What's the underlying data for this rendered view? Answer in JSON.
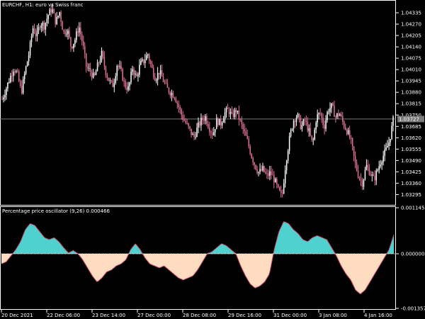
{
  "window": {
    "symbol_title": "EURCHF, H1:  euro vs Swiss franc",
    "indicator_title": "Percentage price oscillator (9,26) 0.000466"
  },
  "colors": {
    "background": "#000000",
    "frame": "#ffffff",
    "bull_candle": "#ffffff",
    "bear_candle": "#e0709a",
    "oscillator_positive": "#4fd1d0",
    "oscillator_negative": "#fddcc0",
    "oscillator_line": "#d05070",
    "current_price_line": "#7a7a7a"
  },
  "chart_data": [
    {
      "type": "candlestick",
      "title": "EURCHF, H1:  euro vs Swiss franc",
      "ylim": [
        1.0324,
        1.044
      ],
      "y_ticks": [
        "1.04335",
        "1.04270",
        "1.04205",
        "1.04140",
        "1.04075",
        "1.04010",
        "1.03945",
        "1.03880",
        "1.03815",
        "1.03750",
        "1.03685",
        "1.03620",
        "1.03555",
        "1.03490",
        "1.03425",
        "1.03360",
        "1.03295"
      ],
      "current_price": 1.03727,
      "current_price_label": "1.03727",
      "x_ticks": [
        "20 Dec 2021",
        "22 Dec 06:00",
        "23 Dec 14:00",
        "27 Dec 00:00",
        "28 Dec 08:00",
        "29 Dec 16:00",
        "31 Dec 00:00",
        "3 Jan 08:00",
        "4 Jan 16:00"
      ],
      "close_path": [
        1.0384,
        1.039,
        1.0396,
        1.0402,
        1.0398,
        1.0388,
        1.04,
        1.041,
        1.0425,
        1.042,
        1.0428,
        1.0426,
        1.0432,
        1.0436,
        1.0428,
        1.0434,
        1.0422,
        1.0424,
        1.0414,
        1.0418,
        1.0426,
        1.0416,
        1.0402,
        1.04,
        1.0396,
        1.0404,
        1.041,
        1.04,
        1.0394,
        1.0392,
        1.0404,
        1.04,
        1.0392,
        1.039,
        1.0402,
        1.0396,
        1.0404,
        1.0406,
        1.041,
        1.0402,
        1.0396,
        1.04,
        1.0395,
        1.039,
        1.0388,
        1.0386,
        1.038,
        1.0374,
        1.037,
        1.0366,
        1.0362,
        1.0368,
        1.0372,
        1.0374,
        1.0368,
        1.0364,
        1.0372,
        1.037,
        1.0376,
        1.0378,
        1.0374,
        1.0378,
        1.0372,
        1.0366,
        1.036,
        1.0352,
        1.0346,
        1.0342,
        1.0344,
        1.034,
        1.0342,
        1.0338,
        1.0332,
        1.0328,
        1.0348,
        1.0362,
        1.0372,
        1.0375,
        1.0368,
        1.0372,
        1.0366,
        1.0358,
        1.0374,
        1.0376,
        1.0368,
        1.0378,
        1.038,
        1.0374,
        1.0376,
        1.037,
        1.0366,
        1.036,
        1.0348,
        1.034,
        1.0336,
        1.0346,
        1.0342,
        1.0338,
        1.0344,
        1.035,
        1.0354,
        1.036,
        1.0372
      ]
    },
    {
      "type": "area",
      "title": "Percentage price oscillator (9,26) 0.000466",
      "ylim": [
        -0.001357,
        0.001145
      ],
      "y_ticks": [
        "0.001145",
        "0.000000",
        "-0.001357"
      ],
      "current_value": 0.000466,
      "values": [
        -0.00025,
        -0.0002,
        -5e-05,
        0.0001,
        0.0003,
        0.0006,
        0.00075,
        0.0007,
        0.00055,
        0.0004,
        0.00035,
        0.0004,
        0.0003,
        0.00015,
        2e-05,
        8e-05,
        0.0,
        -0.00015,
        -0.00035,
        -0.00055,
        -0.0007,
        -0.0006,
        -0.00045,
        -0.0004,
        -0.0003,
        -0.00025,
        -0.00015,
        0.0001,
        0.00025,
        0.0001,
        -0.0001,
        -0.00025,
        -0.0003,
        -0.00035,
        -0.0003,
        -0.0004,
        -0.0005,
        -0.0006,
        -0.00065,
        -0.0006,
        -0.00055,
        -0.0004,
        -0.0002,
        0.0,
        5e-05,
        0.00015,
        0.00025,
        0.0002,
        0.0001,
        0.0,
        -0.0003,
        -0.00055,
        -0.00075,
        -0.00085,
        -0.0008,
        -0.0007,
        -0.0005,
        0.0001,
        0.00055,
        0.0008,
        0.00075,
        0.0006,
        0.0005,
        0.00035,
        0.0003,
        0.0004,
        0.00045,
        0.0004,
        0.00035,
        0.00015,
        -5e-05,
        -0.0003,
        -0.0005,
        -0.00065,
        -0.0009,
        -0.001,
        -0.0009,
        -0.0007,
        -0.0005,
        -0.0003,
        -0.0001,
        0.0001,
        0.00047
      ]
    }
  ]
}
